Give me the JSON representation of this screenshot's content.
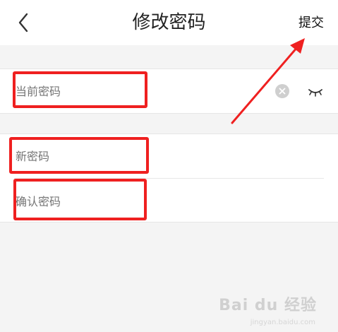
{
  "header": {
    "title": "修改密码",
    "submit_label": "提交",
    "back_icon": "chevron-left-icon"
  },
  "form": {
    "current_password_placeholder": "当前密码",
    "new_password_placeholder": "新密码",
    "confirm_password_placeholder": "确认密码",
    "clear_icon": "clear-icon",
    "visibility_icon": "eye-closed-icon"
  },
  "annotation": {
    "highlight_color": "#ef2020"
  },
  "watermark": {
    "text": "Bai du 经验",
    "sub": "jingyan.baidu.com"
  }
}
